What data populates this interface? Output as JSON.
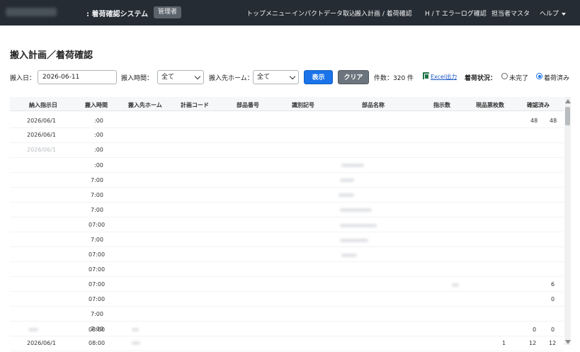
{
  "header": {
    "app_title": ": 着荷確認システム",
    "role_badge": "管理者",
    "nav": [
      "トップメニュー",
      "インパクトデータ取込",
      "搬入計画 / 着荷確認",
      "H / T エラーログ確認",
      "担当者マスタ",
      "ヘルプ"
    ]
  },
  "page": {
    "title": "搬入計画／着荷確認"
  },
  "filters": {
    "date_label": "搬入日：",
    "date_value": "2026-06-11",
    "time_label": "搬入時間：",
    "time_value": "全て",
    "home_label": "搬入先ホーム：",
    "home_value": "全て",
    "show_button": "表示",
    "clear_button": "クリア",
    "count_text": "件数：320 件",
    "excel_label": "Excel出力",
    "status_label": "着荷状況：",
    "status_options": [
      "未完了",
      "着荷済み"
    ],
    "status_selected": "着荷済み"
  },
  "table": {
    "columns": [
      "納入指示日",
      "搬入時間",
      "搬入先ホーム",
      "計画コード",
      "部品番号",
      "識別記号",
      "部品名称",
      "指示数",
      "現品票枚数",
      "確認済み"
    ],
    "rows": [
      [
        "2026/06/1",
        ":00",
        "",
        "",
        "",
        "",
        "",
        "",
        "",
        "48",
        "48"
      ],
      [
        "2026/06/1",
        ":00",
        "",
        "",
        "",
        "",
        "",
        "",
        "",
        "",
        ""
      ],
      [
        "2026/06/1",
        ":00",
        "",
        "",
        "",
        "",
        "",
        "",
        "",
        "",
        ""
      ],
      [
        "",
        ":00",
        "",
        "",
        "",
        "",
        "",
        "",
        "",
        "",
        ""
      ],
      [
        "",
        "7:00",
        "",
        "",
        "",
        "",
        "",
        "",
        "",
        "",
        ""
      ],
      [
        "",
        "7:00",
        "",
        "",
        "",
        "",
        "",
        "",
        "",
        "",
        ""
      ],
      [
        "",
        "7:00",
        "",
        "",
        "",
        "",
        "",
        "",
        "",
        "",
        ""
      ],
      [
        "",
        "07:00",
        "",
        "",
        "",
        "",
        "",
        "",
        "",
        "",
        ""
      ],
      [
        "",
        "7:00",
        "",
        "",
        "",
        "",
        "",
        "",
        "",
        "",
        ""
      ],
      [
        "",
        "07:00",
        "",
        "",
        "",
        "",
        "",
        "",
        "",
        "",
        ""
      ],
      [
        "",
        "07:00",
        "",
        "",
        "",
        "",
        "",
        "",
        "",
        "",
        ""
      ],
      [
        "",
        "07:00",
        "",
        "",
        "",
        "",
        "",
        "",
        "",
        "",
        "6"
      ],
      [
        "",
        "07:00",
        "",
        "",
        "",
        "",
        "",
        "",
        "",
        "",
        "0"
      ],
      [
        "",
        "7:00",
        "",
        "",
        "",
        "",
        "",
        "",
        "",
        "",
        ""
      ],
      [
        "",
        "7:00",
        "",
        "",
        "",
        "",
        "",
        "",
        "",
        "",
        ""
      ],
      [
        "",
        "08:00",
        "",
        "",
        "",
        "",
        "",
        "",
        "",
        "0",
        "0"
      ],
      [
        "2026/06/1",
        "08:00",
        "",
        "",
        "",
        "",
        "",
        "",
        "1",
        "12",
        "12"
      ]
    ]
  }
}
